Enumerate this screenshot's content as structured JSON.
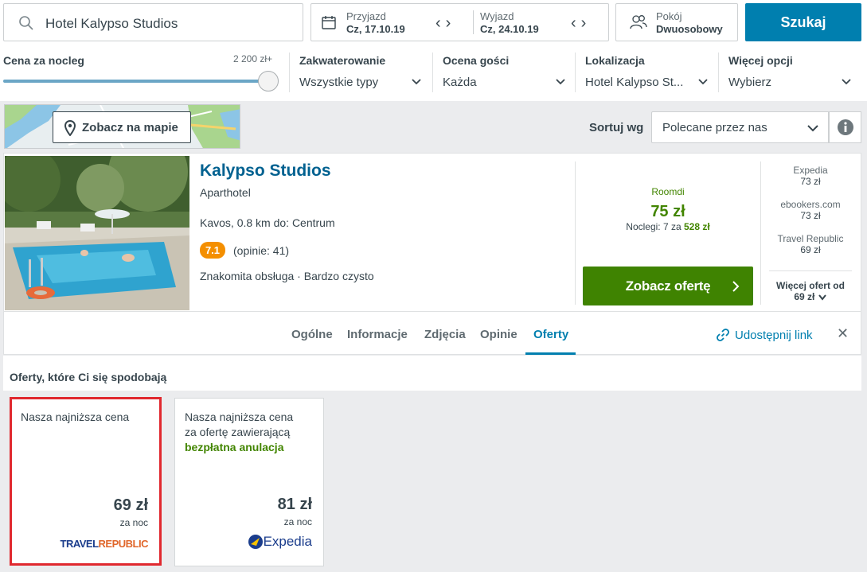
{
  "search": {
    "query": "Hotel Kalypso Studios"
  },
  "dates": {
    "checkin_label": "Przyjazd",
    "checkin_value": "Cz, 17.10.19",
    "checkout_label": "Wyjazd",
    "checkout_value": "Cz, 24.10.19"
  },
  "room": {
    "label": "Pokój",
    "value": "Dwuosobowy"
  },
  "search_button": "Szukaj",
  "filters": {
    "price": {
      "label": "Cena za nocleg",
      "max": "2 200 zł+"
    },
    "accommodation": {
      "label": "Zakwaterowanie",
      "value": "Wszystkie typy"
    },
    "rating": {
      "label": "Ocena gości",
      "value": "Każda"
    },
    "location": {
      "label": "Lokalizacja",
      "value": "Hotel Kalypso St..."
    },
    "more": {
      "label": "Więcej opcji",
      "value": "Wybierz"
    }
  },
  "map_button": "Zobacz na mapie",
  "sort": {
    "label": "Sortuj wg",
    "value": "Polecane przez nas"
  },
  "hotel": {
    "name": "Kalypso Studios",
    "type": "Aparthotel",
    "location": "Kavos, 0.8 km do: Centrum",
    "rating": "7.1",
    "reviews": "(opinie: 41)",
    "tags": "Znakomita obsługa · Bardzo czysto",
    "provider": "Roomdi",
    "price": "75 zł",
    "nights_prefix": "Noclegi: 7 za",
    "nights_total": "528 zł",
    "deal_button": "Zobacz ofertę",
    "alternatives": [
      {
        "name": "Expedia",
        "price": "73 zł"
      },
      {
        "name": "ebookers.com",
        "price": "73 zł"
      },
      {
        "name": "Travel Republic",
        "price": "69 zł"
      }
    ],
    "more_offers_label": "Więcej ofert od",
    "more_offers_price": "69 zł"
  },
  "tabs": [
    {
      "label": "Ogólne"
    },
    {
      "label": "Informacje"
    },
    {
      "label": "Zdjęcia"
    },
    {
      "label": "Opinie"
    },
    {
      "label": "Oferty"
    }
  ],
  "share_link": "Udostępnij link",
  "offers": {
    "heading": "Oferty, które Ci się spodobają",
    "items": [
      {
        "desc": "Nasza najniższa cena",
        "price": "69 zł",
        "per": "za noc",
        "logo": "TRAVELREPUBLIC"
      },
      {
        "desc_line1": "Nasza najniższa cena",
        "desc_line2": "za ofertę zawierającą",
        "desc_highlight": "bezpłatna anulacja",
        "price": "81 zł",
        "per": "za noc",
        "logo": "Expedia"
      }
    ]
  },
  "colors": {
    "brand_blue": "#007faf",
    "deal_green": "#3f8301",
    "rating_orange": "#f48f00",
    "highlight_red": "#e0282e"
  }
}
